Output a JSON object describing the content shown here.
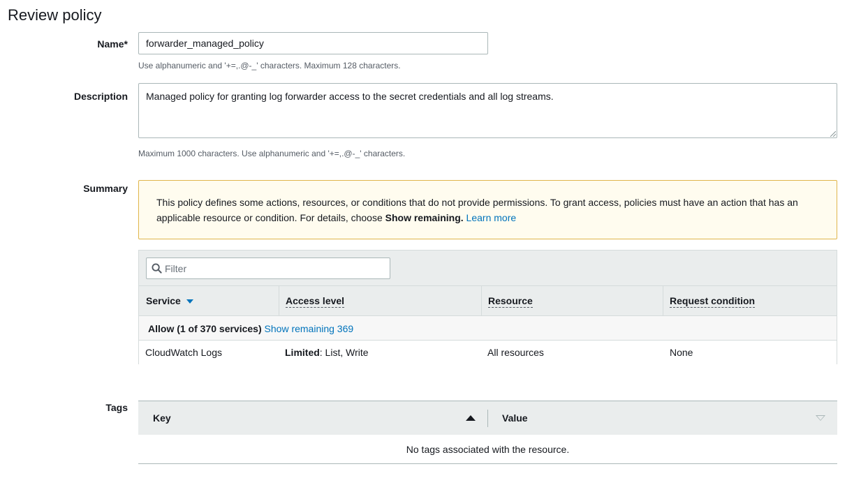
{
  "page": {
    "title": "Review policy"
  },
  "name_field": {
    "label": "Name*",
    "value": "forwarder_managed_policy",
    "hint": "Use alphanumeric and '+=,.@-_' characters. Maximum 128 characters."
  },
  "description_field": {
    "label": "Description",
    "value": "Managed policy for granting log forwarder access to the secret credentials and all log streams.",
    "hint": "Maximum 1000 characters. Use alphanumeric and '+=,.@-_' characters."
  },
  "summary": {
    "label": "Summary",
    "warning": {
      "text_before": "This policy defines some actions, resources, or conditions that do not provide permissions. To grant access, policies must have an action that has an applicable resource or condition. For details, choose ",
      "bold_text": "Show remaining.",
      "link": "Learn more"
    },
    "filter": {
      "placeholder": "Filter",
      "icon": "search-icon"
    },
    "columns": {
      "service": "Service",
      "access_level": "Access level",
      "resource": "Resource",
      "request_condition": "Request condition"
    },
    "group": {
      "label": "Allow (1 of 370 services)",
      "link": "Show remaining 369"
    },
    "rows": [
      {
        "service": "CloudWatch Logs",
        "access_level_bold": "Limited",
        "access_level_rest": ": List, Write",
        "resource": "All resources",
        "request_condition": "None"
      }
    ]
  },
  "tags": {
    "label": "Tags",
    "columns": {
      "key": "Key",
      "value": "Value"
    },
    "empty_message": "No tags associated with the resource."
  },
  "colors": {
    "link": "#0073bb",
    "warning_border": "#e0b54b",
    "warning_bg": "#fffcef",
    "header_bg": "#eaeded"
  }
}
